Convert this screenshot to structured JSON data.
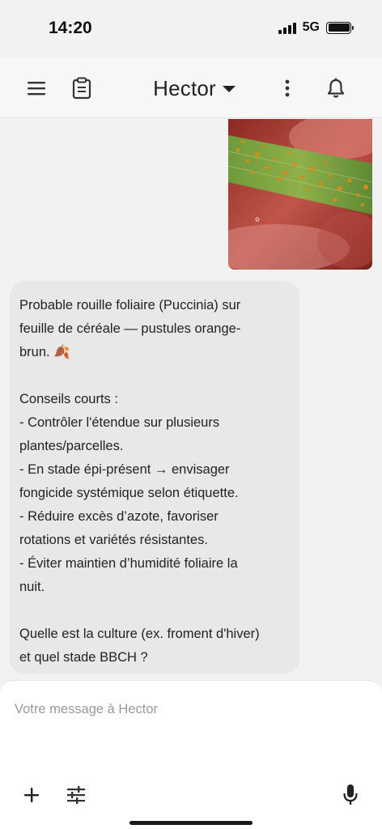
{
  "status_bar": {
    "time": "14:20",
    "network": "5G",
    "signal_bars": 4,
    "battery_level": 1.0
  },
  "header": {
    "title": "Hector",
    "menu_icon": "hamburger-menu-icon",
    "notes_icon": "clipboard-icon",
    "dropdown_icon": "caret-down-icon",
    "more_icon": "more-vertical-icon",
    "notifications_icon": "bell-icon"
  },
  "chat": {
    "user_image": {
      "kind": "photo",
      "subject": "leaf-with-rust-pustules"
    },
    "assistant_message": {
      "text": "Probable rouille foliaire (Puccinia) sur\nfeuille de céréale — pustules orange-\nbrun. 🍂\n\nConseils courts :\n- Contrôler l'étendue sur plusieurs\nplantes/parcelles.\n- En stade épi-présent → envisager\nfongicide systémique selon étiquette.\n- Réduire excès d’azote, favoriser\nrotations et variétés résistantes.\n- Éviter maintien d’humidité foliaire la\nnuit.\n\nQuelle est la culture (ex. froment d'hiver)\net quel stade BBCH ?"
    }
  },
  "composer": {
    "placeholder": "Votre message à Hector",
    "value": "",
    "add_icon": "plus-icon",
    "options_icon": "sliders-icon",
    "mic_icon": "microphone-icon"
  },
  "colors": {
    "background": "#f2f2f2",
    "bubble": "#e8e8e8",
    "text": "#222222",
    "placeholder": "#9a9a9a"
  }
}
